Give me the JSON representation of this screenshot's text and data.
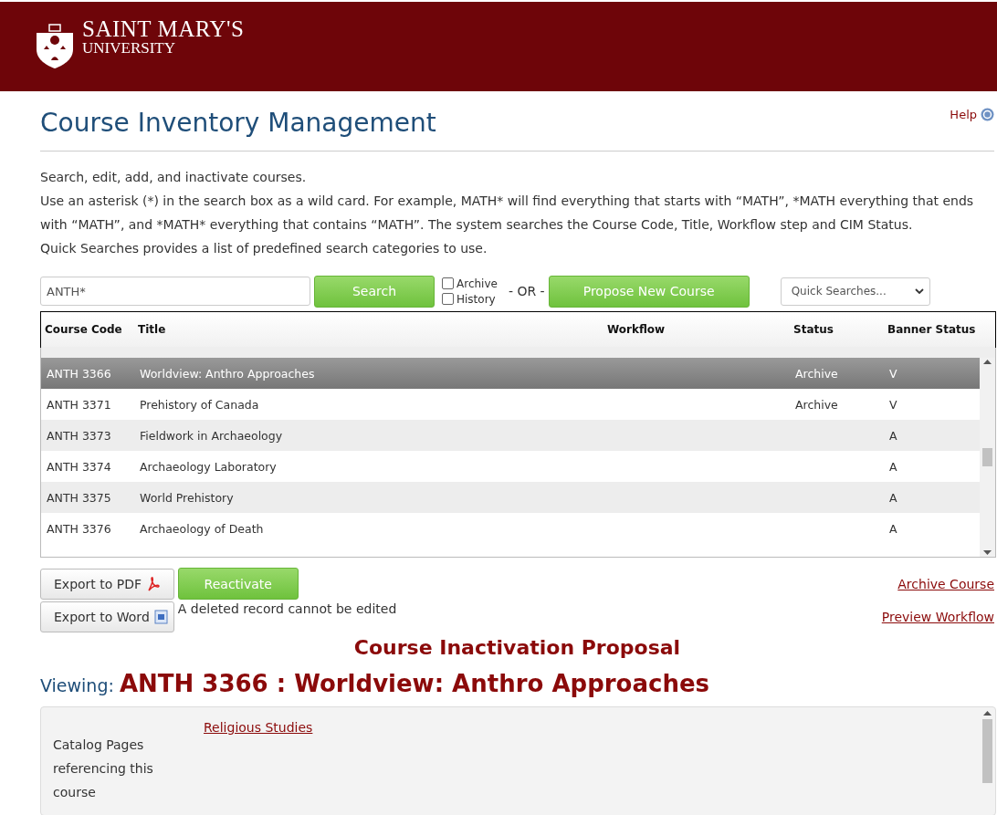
{
  "header": {
    "logo_line1": "SAINT MARY'S",
    "logo_line2": "UNIVERSITY"
  },
  "page": {
    "title": "Course Inventory Management",
    "help": "Help"
  },
  "intro": [
    "Search, edit, add, and inactivate courses.",
    "Use an asterisk (*) in the search box as a wild card. For example, MATH* will find everything that starts with “MATH”, *MATH everything that ends with “MATH”, and *MATH* everything that contains “MATH”. The system searches the Course Code, Title, Workflow step and CIM Status.",
    "Quick Searches provides a list of predefined search categories to use."
  ],
  "search": {
    "value": "ANTH*",
    "button": "Search",
    "options": [
      {
        "label": "Archive",
        "checked": false
      },
      {
        "label": "History",
        "checked": false
      }
    ],
    "or": "- OR -",
    "propose": "Propose New Course",
    "quick": "Quick Searches..."
  },
  "table": {
    "columns": [
      "Course Code",
      "Title",
      "Workflow",
      "Status",
      "Banner Status"
    ],
    "rows": [
      {
        "code": "ANTH 3366",
        "title": "Worldview: Anthro Approaches",
        "workflow": "",
        "status": "Archive",
        "banner": "V",
        "selected": true
      },
      {
        "code": "ANTH 3371",
        "title": "Prehistory of Canada",
        "workflow": "",
        "status": "Archive",
        "banner": "V",
        "selected": false
      },
      {
        "code": "ANTH 3373",
        "title": "Fieldwork in Archaeology",
        "workflow": "",
        "status": "",
        "banner": "A",
        "selected": false
      },
      {
        "code": "ANTH 3374",
        "title": "Archaeology Laboratory",
        "workflow": "",
        "status": "",
        "banner": "A",
        "selected": false
      },
      {
        "code": "ANTH 3375",
        "title": "World Prehistory",
        "workflow": "",
        "status": "",
        "banner": "A",
        "selected": false
      },
      {
        "code": "ANTH 3376",
        "title": "Archaeology of Death",
        "workflow": "",
        "status": "",
        "banner": "A",
        "selected": false
      }
    ]
  },
  "actions": {
    "export_pdf": "Export to PDF",
    "export_word": "Export to Word",
    "reactivate": "Reactivate",
    "note": "A deleted record cannot be edited",
    "archive": "Archive Course",
    "preview": "Preview Workflow"
  },
  "proposal_title": "Course Inactivation Proposal",
  "viewing": {
    "label": "Viewing:",
    "course": "ANTH 3366 : Worldview: Anthro Approaches"
  },
  "detail": {
    "label": "Catalog Pages referencing this course",
    "link": "Religious Studies"
  }
}
